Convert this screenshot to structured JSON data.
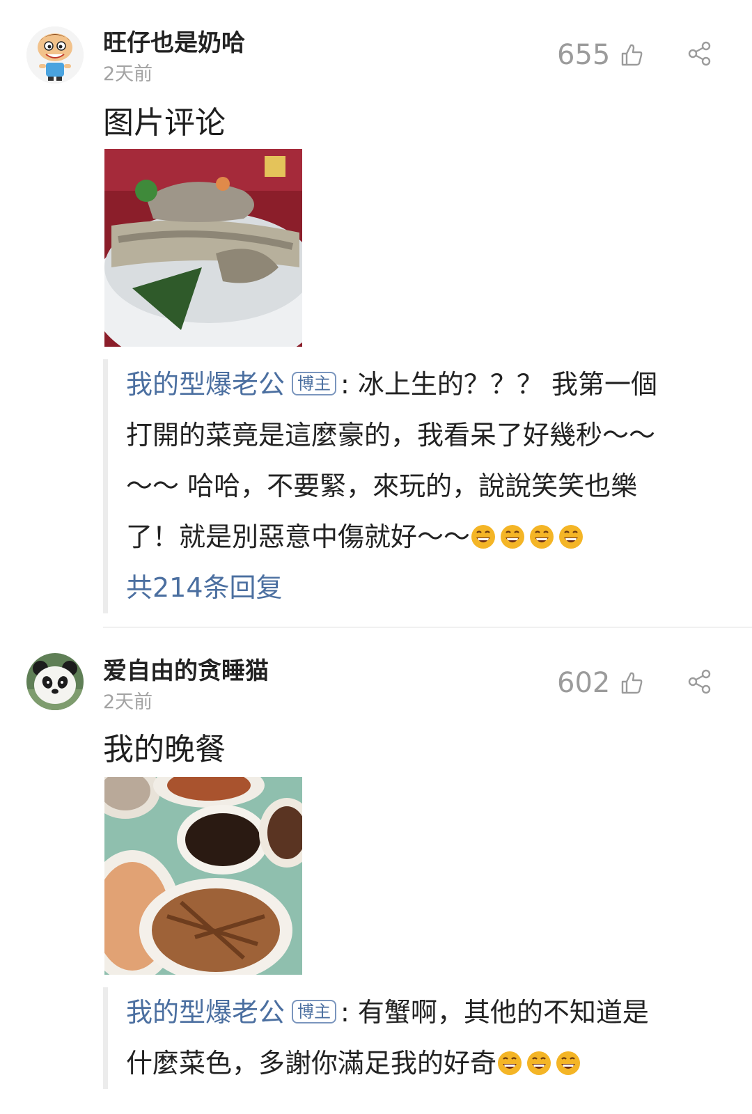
{
  "comments": [
    {
      "username": "旺仔也是奶哈",
      "time": "2天前",
      "likes": "655",
      "text": "图片评论",
      "avatar_icon": "cartoon-boy-avatar",
      "reply": {
        "author": "我的型爆老公",
        "badge": "博主",
        "sep": ":",
        "lines": [
          "冰上生的？？？ 我第一個",
          "打開的菜竟是這麼豪的，我看呆了好幾秒～～",
          "～～ 哈哈，不要緊，來玩的，說說笑笑也樂",
          "了！就是別惡意中傷就好～～"
        ],
        "emoji_count": 4,
        "reply_count": "共214条回复"
      }
    },
    {
      "username": "爱自由的贪睡猫",
      "time": "2天前",
      "likes": "602",
      "text": "我的晚餐",
      "avatar_icon": "panda-avatar",
      "reply": {
        "author": "我的型爆老公",
        "badge": "博主",
        "sep": ":",
        "lines": [
          "有蟹啊，其他的不知道是",
          "什麼菜色，多謝你滿足我的好奇"
        ],
        "emoji_count": 3
      }
    }
  ],
  "colors": {
    "link": "#4b6fa0",
    "muted": "#a3a3a3",
    "emoji": "#f4b526"
  }
}
